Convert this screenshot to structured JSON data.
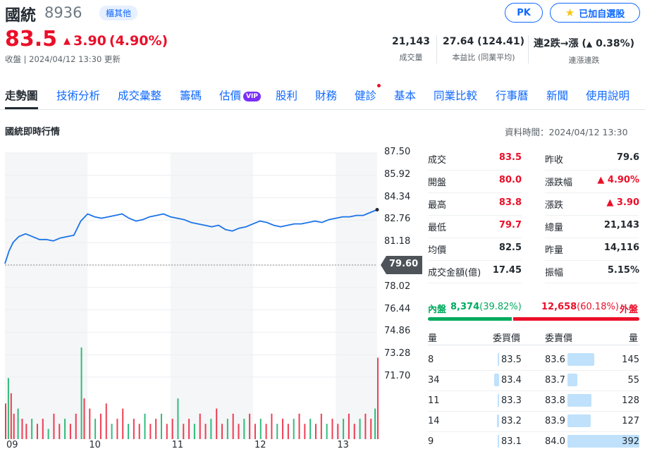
{
  "header": {
    "name": "國統",
    "code": "8936",
    "market_badge": "櫃其他",
    "pk_label": "PK",
    "watchlist_label": "已加自選股",
    "price": "83.5",
    "change": "3.90",
    "change_pct": "(4.90%)",
    "status": "收盤 | 2024/04/12 13:30 更新",
    "stats": [
      {
        "value": "21,143",
        "label": "成交量"
      },
      {
        "value": "27.64 (124.41)",
        "label": "本益比 (同業平均)"
      },
      {
        "value_prefix": "連2跌→漲 (",
        "value_arrow": "▲",
        "value_suffix": " 0.38%)",
        "label": "連漲連跌"
      }
    ]
  },
  "tabs": [
    "走勢圖",
    "技術分析",
    "成交彙整",
    "籌碼",
    "估價",
    "股利",
    "財務",
    "健診",
    "基本",
    "同業比較",
    "行事曆",
    "新聞",
    "使用說明"
  ],
  "vip_label": "VIP",
  "section": {
    "title": "國統即時行情",
    "data_time": "資料時間：2024/04/12 13:30"
  },
  "prev_close_tag": "79.60",
  "colors": {
    "up": "#eb0f29",
    "down": "#00ab5e",
    "accent": "#0f69ff",
    "line": "#1a73e8"
  },
  "chart_data": {
    "type": "line",
    "y_ticks": [
      "87.50",
      "85.92",
      "84.34",
      "82.76",
      "81.18",
      "79.60",
      "78.02",
      "76.44",
      "74.86",
      "73.28",
      "71.70"
    ],
    "x_ticks": [
      "09",
      "10",
      "11",
      "12",
      "13"
    ],
    "ylim": [
      71.7,
      87.5
    ],
    "reference_line": 79.6,
    "price_series": [
      {
        "t": 0,
        "v": 79.7
      },
      {
        "t": 3,
        "v": 80.6
      },
      {
        "t": 6,
        "v": 81.2
      },
      {
        "t": 10,
        "v": 81.6
      },
      {
        "t": 15,
        "v": 81.8
      },
      {
        "t": 20,
        "v": 81.6
      },
      {
        "t": 25,
        "v": 81.4
      },
      {
        "t": 30,
        "v": 81.4
      },
      {
        "t": 35,
        "v": 81.3
      },
      {
        "t": 40,
        "v": 81.5
      },
      {
        "t": 45,
        "v": 81.6
      },
      {
        "t": 50,
        "v": 81.7
      },
      {
        "t": 55,
        "v": 82.7
      },
      {
        "t": 60,
        "v": 83.2
      },
      {
        "t": 65,
        "v": 83.0
      },
      {
        "t": 70,
        "v": 82.9
      },
      {
        "t": 75,
        "v": 83.0
      },
      {
        "t": 80,
        "v": 83.1
      },
      {
        "t": 85,
        "v": 83.2
      },
      {
        "t": 90,
        "v": 82.9
      },
      {
        "t": 95,
        "v": 82.7
      },
      {
        "t": 100,
        "v": 82.8
      },
      {
        "t": 105,
        "v": 83.0
      },
      {
        "t": 110,
        "v": 83.1
      },
      {
        "t": 115,
        "v": 83.2
      },
      {
        "t": 120,
        "v": 83.0
      },
      {
        "t": 125,
        "v": 82.9
      },
      {
        "t": 130,
        "v": 82.8
      },
      {
        "t": 135,
        "v": 82.6
      },
      {
        "t": 140,
        "v": 82.5
      },
      {
        "t": 145,
        "v": 82.4
      },
      {
        "t": 150,
        "v": 82.3
      },
      {
        "t": 155,
        "v": 82.4
      },
      {
        "t": 160,
        "v": 82.1
      },
      {
        "t": 165,
        "v": 82.0
      },
      {
        "t": 170,
        "v": 82.2
      },
      {
        "t": 175,
        "v": 82.3
      },
      {
        "t": 180,
        "v": 82.5
      },
      {
        "t": 185,
        "v": 82.7
      },
      {
        "t": 190,
        "v": 82.6
      },
      {
        "t": 195,
        "v": 82.4
      },
      {
        "t": 200,
        "v": 82.3
      },
      {
        "t": 205,
        "v": 82.4
      },
      {
        "t": 210,
        "v": 82.5
      },
      {
        "t": 215,
        "v": 82.5
      },
      {
        "t": 220,
        "v": 82.6
      },
      {
        "t": 225,
        "v": 82.7
      },
      {
        "t": 230,
        "v": 82.6
      },
      {
        "t": 235,
        "v": 82.8
      },
      {
        "t": 240,
        "v": 82.9
      },
      {
        "t": 245,
        "v": 83.0
      },
      {
        "t": 250,
        "v": 83.0
      },
      {
        "t": 255,
        "v": 83.1
      },
      {
        "t": 260,
        "v": 83.1
      },
      {
        "t": 265,
        "v": 83.3
      },
      {
        "t": 270,
        "v": 83.5
      }
    ],
    "volume_series": [
      {
        "t": 0,
        "vol": 7
      },
      {
        "t": 2,
        "vol": 12
      },
      {
        "t": 4,
        "vol": 9
      },
      {
        "t": 6,
        "vol": 5
      },
      {
        "t": 9,
        "vol": 6
      },
      {
        "t": 12,
        "vol": 4
      },
      {
        "t": 15,
        "vol": 3
      },
      {
        "t": 19,
        "vol": 4
      },
      {
        "t": 23,
        "vol": 3
      },
      {
        "t": 27,
        "vol": 4
      },
      {
        "t": 31,
        "vol": 2
      },
      {
        "t": 35,
        "vol": 5
      },
      {
        "t": 39,
        "vol": 3
      },
      {
        "t": 43,
        "vol": 4
      },
      {
        "t": 47,
        "vol": 3
      },
      {
        "t": 51,
        "vol": 5
      },
      {
        "t": 55,
        "vol": 18
      },
      {
        "t": 57,
        "vol": 8
      },
      {
        "t": 61,
        "vol": 6
      },
      {
        "t": 65,
        "vol": 4
      },
      {
        "t": 69,
        "vol": 5
      },
      {
        "t": 73,
        "vol": 7
      },
      {
        "t": 77,
        "vol": 3
      },
      {
        "t": 81,
        "vol": 4
      },
      {
        "t": 85,
        "vol": 6
      },
      {
        "t": 89,
        "vol": 3
      },
      {
        "t": 93,
        "vol": 4
      },
      {
        "t": 97,
        "vol": 3
      },
      {
        "t": 101,
        "vol": 5
      },
      {
        "t": 105,
        "vol": 3
      },
      {
        "t": 109,
        "vol": 4
      },
      {
        "t": 113,
        "vol": 5
      },
      {
        "t": 117,
        "vol": 3
      },
      {
        "t": 121,
        "vol": 4
      },
      {
        "t": 125,
        "vol": 8
      },
      {
        "t": 129,
        "vol": 3
      },
      {
        "t": 133,
        "vol": 4
      },
      {
        "t": 137,
        "vol": 3
      },
      {
        "t": 141,
        "vol": 5
      },
      {
        "t": 145,
        "vol": 3
      },
      {
        "t": 149,
        "vol": 4
      },
      {
        "t": 153,
        "vol": 6
      },
      {
        "t": 157,
        "vol": 3
      },
      {
        "t": 161,
        "vol": 4
      },
      {
        "t": 165,
        "vol": 5
      },
      {
        "t": 169,
        "vol": 3
      },
      {
        "t": 173,
        "vol": 4
      },
      {
        "t": 177,
        "vol": 5
      },
      {
        "t": 181,
        "vol": 3
      },
      {
        "t": 185,
        "vol": 4
      },
      {
        "t": 189,
        "vol": 3
      },
      {
        "t": 193,
        "vol": 5
      },
      {
        "t": 197,
        "vol": 3
      },
      {
        "t": 201,
        "vol": 4
      },
      {
        "t": 205,
        "vol": 3
      },
      {
        "t": 209,
        "vol": 4
      },
      {
        "t": 213,
        "vol": 5
      },
      {
        "t": 217,
        "vol": 3
      },
      {
        "t": 221,
        "vol": 4
      },
      {
        "t": 225,
        "vol": 3
      },
      {
        "t": 229,
        "vol": 5
      },
      {
        "t": 233,
        "vol": 3
      },
      {
        "t": 237,
        "vol": 4
      },
      {
        "t": 241,
        "vol": 3
      },
      {
        "t": 245,
        "vol": 4
      },
      {
        "t": 249,
        "vol": 5
      },
      {
        "t": 253,
        "vol": 3
      },
      {
        "t": 257,
        "vol": 4
      },
      {
        "t": 261,
        "vol": 5
      },
      {
        "t": 265,
        "vol": 4
      },
      {
        "t": 268,
        "vol": 6
      },
      {
        "t": 270,
        "vol": 16
      }
    ]
  },
  "quote": [
    {
      "l": "成交",
      "v": "83.5",
      "c": "up",
      "l2": "昨收",
      "v2": "79.6",
      "c2": ""
    },
    {
      "l": "開盤",
      "v": "80.0",
      "c": "up",
      "l2": "漲跌幅",
      "v2": "▲ 4.90%",
      "c2": "up"
    },
    {
      "l": "最高",
      "v": "83.8",
      "c": "up",
      "l2": "漲跌",
      "v2": "▲ 3.90",
      "c2": "up"
    },
    {
      "l": "最低",
      "v": "79.7",
      "c": "up",
      "l2": "總量",
      "v2": "21,143",
      "c2": ""
    },
    {
      "l": "均價",
      "v": "82.5",
      "c": "",
      "l2": "昨量",
      "v2": "14,116",
      "c2": ""
    },
    {
      "l": "成交金額(億)",
      "v": "17.45",
      "c": "",
      "l2": "振幅",
      "v2": "5.15%",
      "c2": ""
    }
  ],
  "inout": {
    "in_label": "內盤",
    "in_value": "8,374",
    "in_pct": "(39.82%)",
    "out_value": "12,658",
    "out_pct": "(60.18%)",
    "out_label": "外盤",
    "in_fraction": 0.3982
  },
  "orderbook": {
    "headers": [
      "量",
      "委買價",
      "委賣價",
      "量"
    ],
    "rows": [
      {
        "bq": "8",
        "bp": "83.5",
        "ap": "83.6",
        "aq": "145",
        "bfrac": 0.02,
        "afrac": 0.37
      },
      {
        "bq": "34",
        "bp": "83.4",
        "ap": "83.7",
        "aq": "55",
        "bfrac": 0.09,
        "afrac": 0.14
      },
      {
        "bq": "11",
        "bp": "83.3",
        "ap": "83.8",
        "aq": "128",
        "bfrac": 0.03,
        "afrac": 0.33
      },
      {
        "bq": "14",
        "bp": "83.2",
        "ap": "83.9",
        "aq": "127",
        "bfrac": 0.04,
        "afrac": 0.32
      },
      {
        "bq": "9",
        "bp": "83.1",
        "ap": "84.0",
        "aq": "392",
        "bfrac": 0.02,
        "afrac": 1.0
      }
    ]
  }
}
